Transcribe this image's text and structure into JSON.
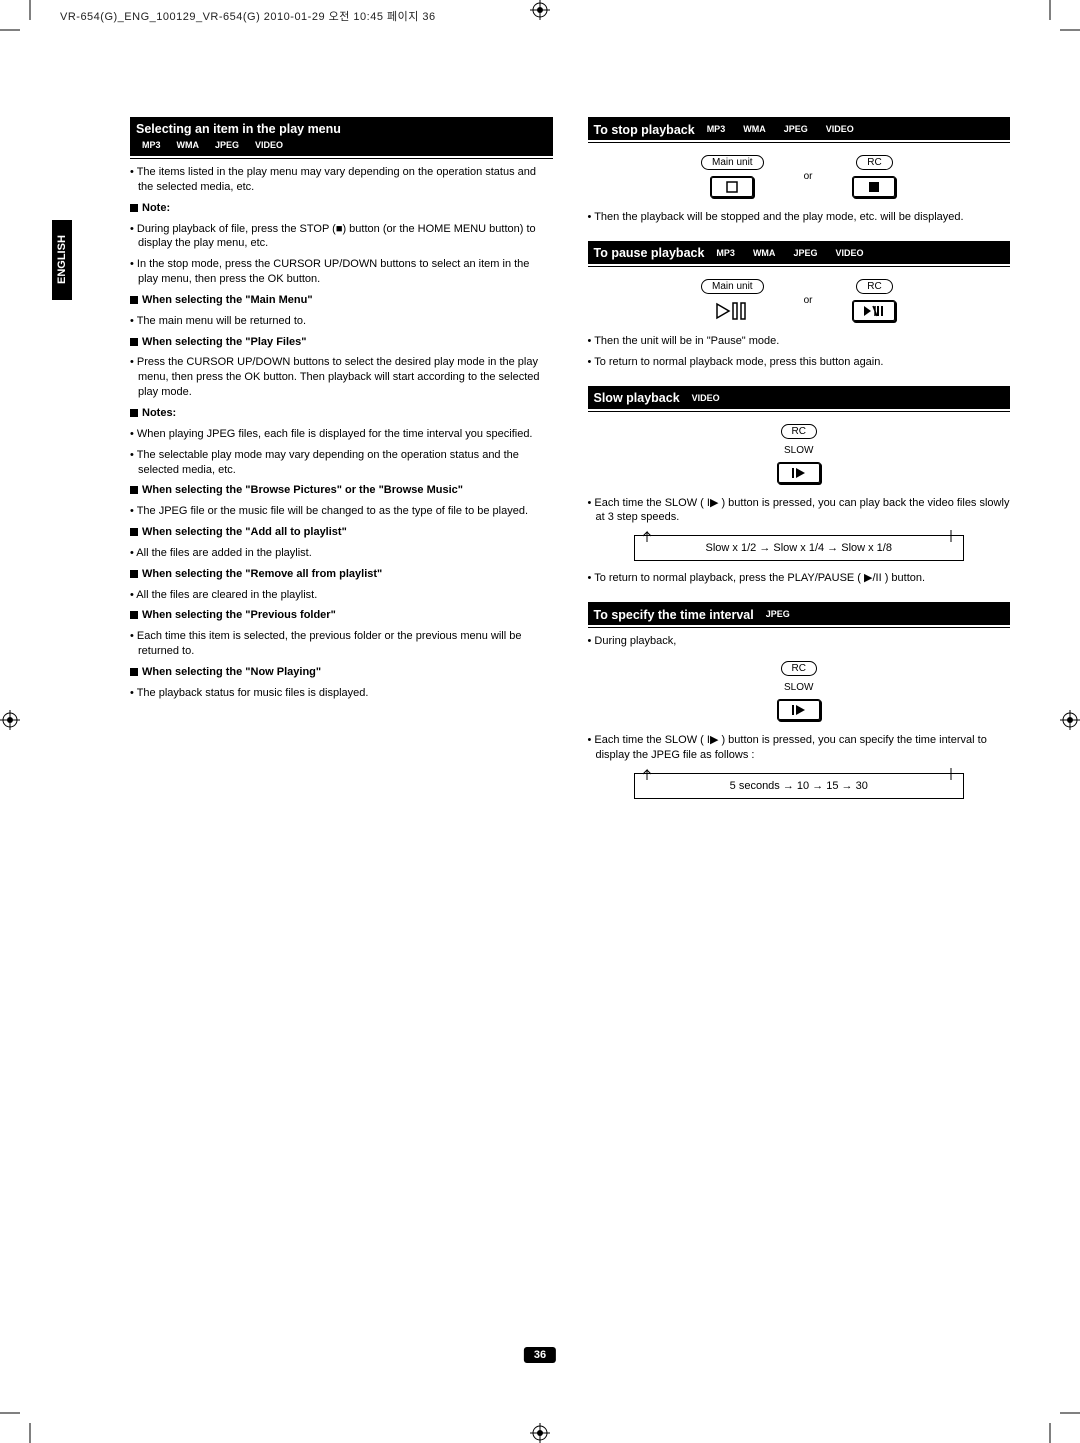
{
  "header_line": "VR-654(G)_ENG_100129_VR-654(G)  2010-01-29  오전 10:45  페이지 36",
  "side_tab": "ENGLISH",
  "page_number": "36",
  "pills": {
    "mp3": "MP3",
    "wma": "WMA",
    "jpeg": "JPEG",
    "video": "VIDEO"
  },
  "left": {
    "title": "Selecting an item in the play menu",
    "intro": "• The items listed in the play menu may vary depending on the operation status and the selected media, etc.",
    "note_head": "Note:",
    "note1": "• During playback of file, press the STOP (■) button (or the HOME MENU button) to display the play menu, etc.",
    "note2": "• In the stop mode, press the CURSOR UP/DOWN buttons to select an item in the play menu, then press the OK button.",
    "h_main": "When selecting the \"Main Menu\"",
    "p_main": "• The main menu will be returned to.",
    "h_play": "When selecting the \"Play Files\"",
    "p_play": "• Press the CURSOR UP/DOWN buttons to select the desired play mode in the play menu, then press the OK button. Then playback will start according to the selected play mode.",
    "notes_head": "Notes:",
    "p_notes1": "• When playing JPEG files, each file is displayed for the time interval you specified.",
    "p_notes2": "• The selectable play mode may vary depending on the operation status and the selected media, etc.",
    "h_browse": "When selecting the \"Browse Pictures\" or the \"Browse Music\"",
    "p_browse": "• The JPEG file or the music file will be changed to as the type of file to be played.",
    "h_addall": "When selecting the \"Add all to playlist\"",
    "p_addall": "• All the files are added in the playlist.",
    "h_removeall": "When selecting the \"Remove all from playlist\"",
    "p_removeall": "• All the files are cleared in the playlist.",
    "h_prev": "When selecting the \"Previous folder\"",
    "p_prev": "• Each time this item is selected, the previous folder or the previous menu will be returned to.",
    "h_now": "When selecting the \"Now Playing\"",
    "p_now": "• The playback status for music files is displayed."
  },
  "right": {
    "stop_title": "To stop playback",
    "mainunit": "Main unit",
    "rc": "RC",
    "or": "or",
    "stop_text": "• Then the playback will be stopped and the play mode, etc. will be displayed.",
    "pause_title": "To pause playback",
    "pause_text1": "• Then the unit will be in \"Pause\" mode.",
    "pause_text2": "• To return to normal playback mode, press this button again.",
    "slow_title": "Slow playback",
    "slow_label": "SLOW",
    "slow_text1": "• Each time the SLOW ( I▶ ) button is pressed, you can play back the video files slowly at 3 step speeds.",
    "slow_cycle": "Slow x 1/2   →   Slow x 1/4   →   Slow x 1/8",
    "slow_text2": "• To return to normal playback, press the PLAY/PAUSE ( ▶/II ) button.",
    "interval_title": "To specify the time interval",
    "interval_text1": "• During playback,",
    "interval_text2": "• Each time the SLOW ( I▶ ) button is pressed, you can specify the time interval to display the JPEG file as follows :",
    "interval_cycle": "5 seconds   →   10   →   15   →   30"
  }
}
